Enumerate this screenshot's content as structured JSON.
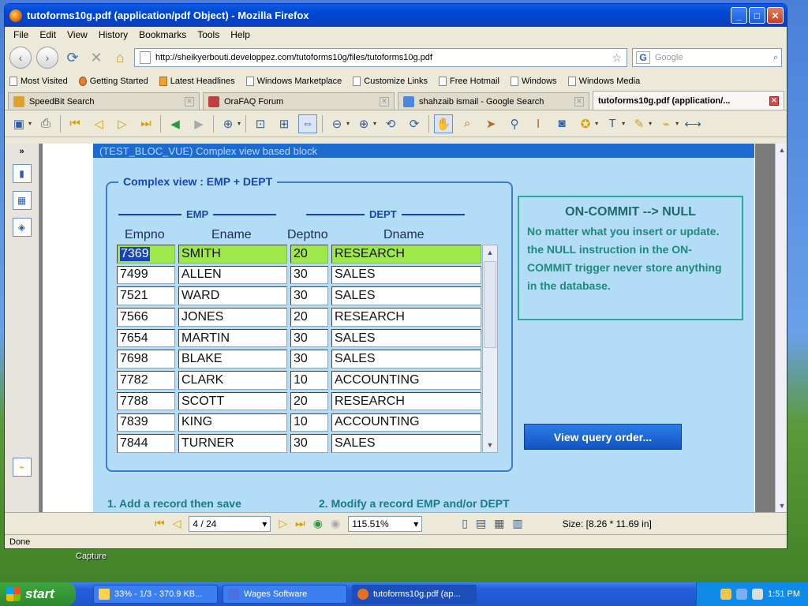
{
  "window": {
    "title": "tutoforms10g.pdf (application/pdf Object) - Mozilla Firefox",
    "min": "_",
    "max": "□",
    "close": "✕"
  },
  "menu": [
    "File",
    "Edit",
    "View",
    "History",
    "Bookmarks",
    "Tools",
    "Help"
  ],
  "url": "http://sheikyerbouti.developpez.com/tutoforms10g/files/tutoforms10g.pdf",
  "search": {
    "engine": "G",
    "placeholder": "Google"
  },
  "bookmarks": [
    "Most Visited",
    "Getting Started",
    "Latest Headlines",
    "Windows Marketplace",
    "Customize Links",
    "Free Hotmail",
    "Windows",
    "Windows Media"
  ],
  "tabs": [
    {
      "label": "SpeedBit Search",
      "active": false
    },
    {
      "label": "OraFAQ Forum",
      "active": false
    },
    {
      "label": "shahzaib ismail - Google Search",
      "active": false
    },
    {
      "label": "tutoforms10g.pdf (application/...",
      "active": true
    }
  ],
  "slide": {
    "header": "(TEST_BLOC_VUE)  Complex view based block",
    "group_title": "Complex view : EMP + DEPT",
    "sub_emp": "EMP",
    "sub_dept": "DEPT",
    "columns": [
      "Empno",
      "Ename",
      "Deptno",
      "Dname"
    ],
    "rows": [
      [
        "7369",
        "SMITH",
        "20",
        "RESEARCH"
      ],
      [
        "7499",
        "ALLEN",
        "30",
        "SALES"
      ],
      [
        "7521",
        "WARD",
        "30",
        "SALES"
      ],
      [
        "7566",
        "JONES",
        "20",
        "RESEARCH"
      ],
      [
        "7654",
        "MARTIN",
        "30",
        "SALES"
      ],
      [
        "7698",
        "BLAKE",
        "30",
        "SALES"
      ],
      [
        "7782",
        "CLARK",
        "10",
        "ACCOUNTING"
      ],
      [
        "7788",
        "SCOTT",
        "20",
        "RESEARCH"
      ],
      [
        "7839",
        "KING",
        "10",
        "ACCOUNTING"
      ],
      [
        "7844",
        "TURNER",
        "30",
        "SALES"
      ]
    ],
    "note_title": "ON-COMMIT --> NULL",
    "note_body": "No matter what you insert or update. the NULL instruction in the ON-COMMIT trigger never store anything in the database.",
    "button": "View query order...",
    "foot1": "1. Add a record then save",
    "foot2": "2. Modify a record EMP and/or DEPT"
  },
  "pdfnav": {
    "page": "4 / 24",
    "zoom": "115.51%",
    "size": "Size: [8.26 * 11.69 in]"
  },
  "status": "Done",
  "desktop_label": "Capture",
  "taskbar": {
    "start": "start",
    "tasks": [
      "33% - 1/3 - 370.9 KB...",
      "Wages Software",
      "tutoforms10g.pdf (ap..."
    ],
    "time": "1:51 PM"
  }
}
